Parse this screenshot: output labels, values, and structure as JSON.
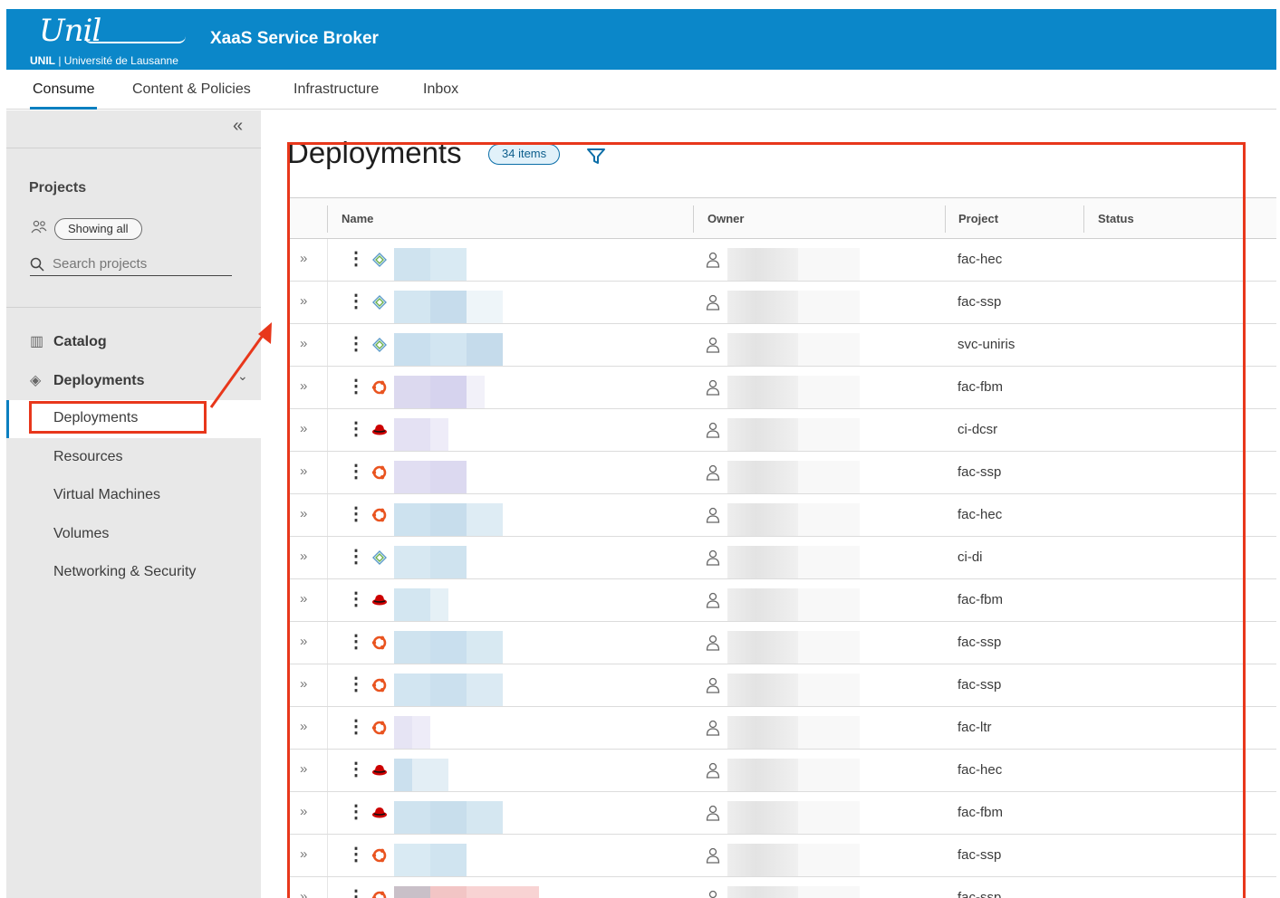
{
  "header": {
    "logo_script": "Unil",
    "logo_sub_bold": "UNIL",
    "logo_sub_rest": " | Université de Lausanne",
    "app_title": "XaaS Service Broker",
    "color": "#0b87c9"
  },
  "topnav": {
    "tabs": [
      {
        "label": "Consume",
        "active": true
      },
      {
        "label": "Content & Policies",
        "active": false
      },
      {
        "label": "Infrastructure",
        "active": false
      },
      {
        "label": "Inbox",
        "active": false
      }
    ]
  },
  "sidebar": {
    "collapse_glyph": "«",
    "projects_title": "Projects",
    "showing_label": "Showing all",
    "search_placeholder": "Search projects",
    "catalog_label": "Catalog",
    "deployments_label": "Deployments",
    "sub_items": [
      "Deployments",
      "Resources",
      "Virtual Machines",
      "Volumes",
      "Networking & Security"
    ],
    "active_sub": "Deployments"
  },
  "main": {
    "title": "Deployments",
    "count_badge": "34 items",
    "columns": [
      "Name",
      "Owner",
      "Project",
      "Status"
    ],
    "rows": [
      {
        "icon": "vmware-icon",
        "project": "fac-hec"
      },
      {
        "icon": "vmware-icon",
        "project": "fac-ssp"
      },
      {
        "icon": "vmware-icon",
        "project": "svc-uniris"
      },
      {
        "icon": "ubuntu-icon",
        "project": "fac-fbm"
      },
      {
        "icon": "redhat-icon",
        "project": "ci-dcsr"
      },
      {
        "icon": "ubuntu-icon",
        "project": "fac-ssp"
      },
      {
        "icon": "ubuntu-icon",
        "project": "fac-hec"
      },
      {
        "icon": "vmware-icon",
        "project": "ci-di"
      },
      {
        "icon": "redhat-icon",
        "project": "fac-fbm"
      },
      {
        "icon": "ubuntu-icon",
        "project": "fac-ssp"
      },
      {
        "icon": "ubuntu-icon",
        "project": "fac-ssp"
      },
      {
        "icon": "ubuntu-icon",
        "project": "fac-ltr"
      },
      {
        "icon": "redhat-icon",
        "project": "fac-hec"
      },
      {
        "icon": "redhat-icon",
        "project": "fac-fbm"
      },
      {
        "icon": "ubuntu-icon",
        "project": "fac-ssp"
      },
      {
        "icon": "ubuntu-icon",
        "project": "fac-ssp"
      }
    ]
  },
  "annotation_color": "#e8371b"
}
